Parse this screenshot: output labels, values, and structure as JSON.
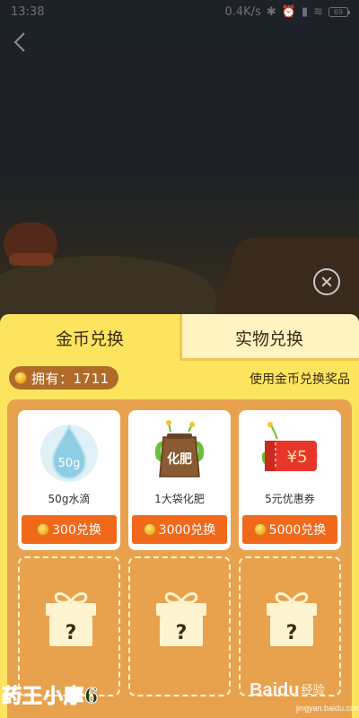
{
  "status_bar": {
    "time": "13:38",
    "network_speed": "0.4K/s",
    "battery": "69"
  },
  "overlay": {
    "back_icon": "chevron-left-icon",
    "close_icon": "close-circle-icon"
  },
  "exchange_panel": {
    "tabs": [
      {
        "label": "金币兑换",
        "active": true
      },
      {
        "label": "实物兑换",
        "active": false
      }
    ],
    "owned_label": "拥有：1711",
    "hint": "使用金币兑换奖品",
    "items": [
      {
        "name": "50g水滴",
        "image_text": "50g",
        "button_label": "300兑换",
        "icon": "water-drop-icon"
      },
      {
        "name": "1大袋化肥",
        "image_text": "化肥",
        "button_label": "3000兑换",
        "icon": "fertilizer-bag-icon"
      },
      {
        "name": "5元优惠券",
        "image_text": "¥5",
        "button_label": "5000兑换",
        "icon": "coupon-icon"
      }
    ],
    "mystery_slots": [
      {
        "icon": "gift-question-icon",
        "symbol": "?"
      },
      {
        "icon": "gift-question-icon",
        "symbol": "?"
      },
      {
        "icon": "gift-question-icon",
        "symbol": "?"
      }
    ]
  },
  "watermarks": {
    "left": "药王小摩6",
    "right_main": "Baidu",
    "right_sub": "经验",
    "url": "jingyan.baidu.com"
  },
  "colors": {
    "panel": "#fde45f",
    "grid_bg": "#e8a24e",
    "button": "#f2681a",
    "owned_badge": "#b06b2a"
  }
}
